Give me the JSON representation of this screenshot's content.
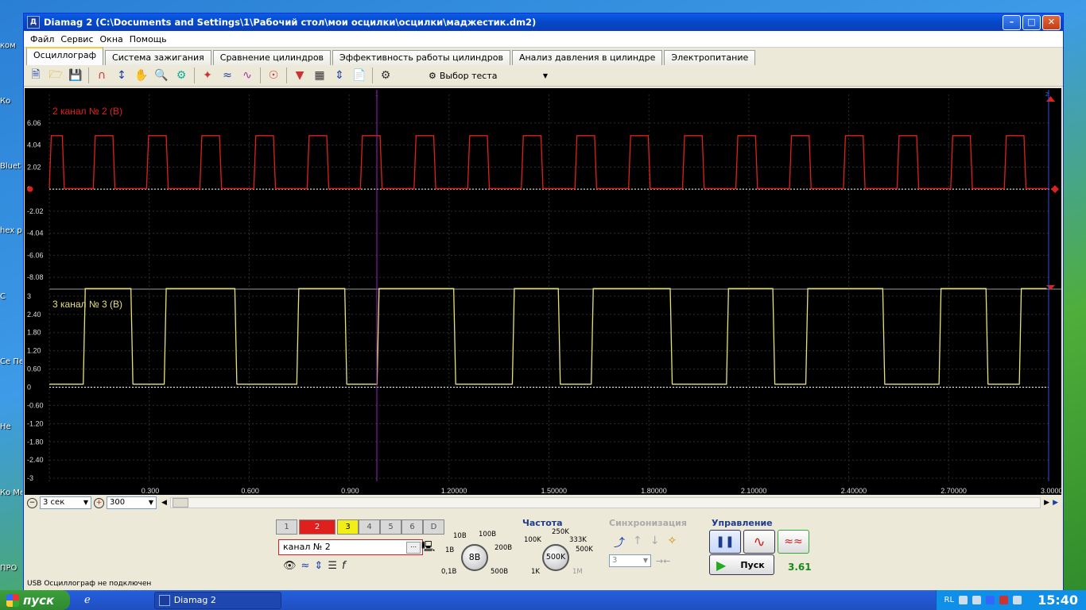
{
  "desktop": {
    "labels": [
      "ком",
      "Ко",
      "Bluet",
      "hex p",
      "С",
      "Се Перс",
      "Не",
      "Ко Ме",
      "ПРО"
    ]
  },
  "window": {
    "title": "Diamag 2 (C:\\Documents and Settings\\1\\Рабочий стол\\мои осцилки\\осцилки\\маджестик.dm2)",
    "app_icon": "Д"
  },
  "menu": [
    "Файл",
    "Сервис",
    "Окна",
    "Помощь"
  ],
  "tabs": [
    {
      "label": "Осциллограф",
      "active": true
    },
    {
      "label": "Система зажигания",
      "active": false
    },
    {
      "label": "Сравнение цилиндров",
      "active": false
    },
    {
      "label": "Эффективность работы цилиндров",
      "active": false
    },
    {
      "label": "Анализ давления в цилиндре",
      "active": false
    },
    {
      "label": "Электропитание",
      "active": false
    }
  ],
  "toolbar": {
    "test_select": "Выбор теста"
  },
  "scope": {
    "channel2_label": "2  канал № 2 (В)",
    "channel3_label": "3  канал № 3 (В)",
    "ch2_ticks": [
      "6.06",
      "4.04",
      "2.02",
      "0",
      "-2.02",
      "-4.04",
      "-6.06",
      "-8.08"
    ],
    "ch3_ticks": [
      "3",
      "2.40",
      "1.80",
      "1.20",
      "0.60",
      "0",
      "-0.60",
      "-1.20",
      "-1.80",
      "-2.40",
      "-3"
    ],
    "x_ticks": [
      "0.300",
      "0.600",
      "0.900",
      "1.20000",
      "1.50000",
      "1.80000",
      "2.10000",
      "2.40000",
      "2.70000",
      "3.00000"
    ],
    "marker_left": "1",
    "marker_right": "2",
    "colors": {
      "ch2": "#e0201c",
      "ch3": "#e8e07a",
      "cursor": "#a020c0",
      "grid": "#2e2e2e"
    }
  },
  "chart_data": {
    "type": "line",
    "title": "",
    "xlabel": "",
    "ylabel": "",
    "xlim": [
      0,
      3.0
    ],
    "series": [
      {
        "name": "2  канал № 2 (В)",
        "type": "square",
        "high": 4.9,
        "low": 0.05,
        "ylim": [
          -8.8,
          7.8
        ],
        "pulses": [
          [
            0.0,
            0.045
          ],
          [
            0.132,
            0.197
          ],
          [
            0.292,
            0.357
          ],
          [
            0.452,
            0.517
          ],
          [
            0.614,
            0.679
          ],
          [
            0.774,
            0.839
          ],
          [
            0.934,
            0.999
          ],
          [
            1.095,
            1.16
          ],
          [
            1.256,
            1.321
          ],
          [
            1.417,
            1.482
          ],
          [
            1.578,
            1.643
          ],
          [
            1.739,
            1.804
          ],
          [
            1.901,
            1.966
          ],
          [
            2.061,
            2.126
          ],
          [
            2.222,
            2.287
          ],
          [
            2.384,
            2.449
          ],
          [
            2.545,
            2.61
          ],
          [
            2.706,
            2.771
          ],
          [
            2.867,
            2.932
          ]
        ]
      },
      {
        "name": "3  канал № 3 (В)",
        "type": "square",
        "high": 3.25,
        "low": 0.1,
        "ylim": [
          -3.1,
          3.1
        ],
        "pulses": [
          [
            0.102,
            0.251
          ],
          [
            0.345,
            0.563
          ],
          [
            0.743,
            0.893
          ],
          [
            0.984,
            1.22
          ],
          [
            1.39,
            1.534
          ],
          [
            1.627,
            1.87
          ],
          [
            2.033,
            2.178
          ],
          [
            2.271,
            2.508
          ],
          [
            2.671,
            2.818
          ],
          [
            2.912,
            3.0
          ]
        ]
      }
    ]
  },
  "bottom": {
    "time_window": "3 сек",
    "zoom": "300",
    "channel_buttons": [
      "1",
      "2",
      "3",
      "4",
      "5",
      "6",
      "D"
    ],
    "channel_name": "канал № 2",
    "volt_scale": {
      "value": "8В",
      "labels": [
        "10В",
        "100В",
        "1В",
        "200В",
        "0,1В",
        "500В"
      ]
    },
    "freq_title": "Частота",
    "freq": {
      "value": "500K",
      "labels": [
        "100K",
        "250K",
        "333K",
        "500K",
        "1K",
        "1M"
      ]
    },
    "sync_title": "Синхронизация",
    "sync_channel": "3",
    "control_title": "Управление",
    "start_label": "Пуск",
    "value_readout": "3.61"
  },
  "status_text": "USB Осциллограф не подключен",
  "taskbar": {
    "start": "пуск",
    "task": "Diamag 2",
    "lang": "RL",
    "clock": "15:40"
  }
}
